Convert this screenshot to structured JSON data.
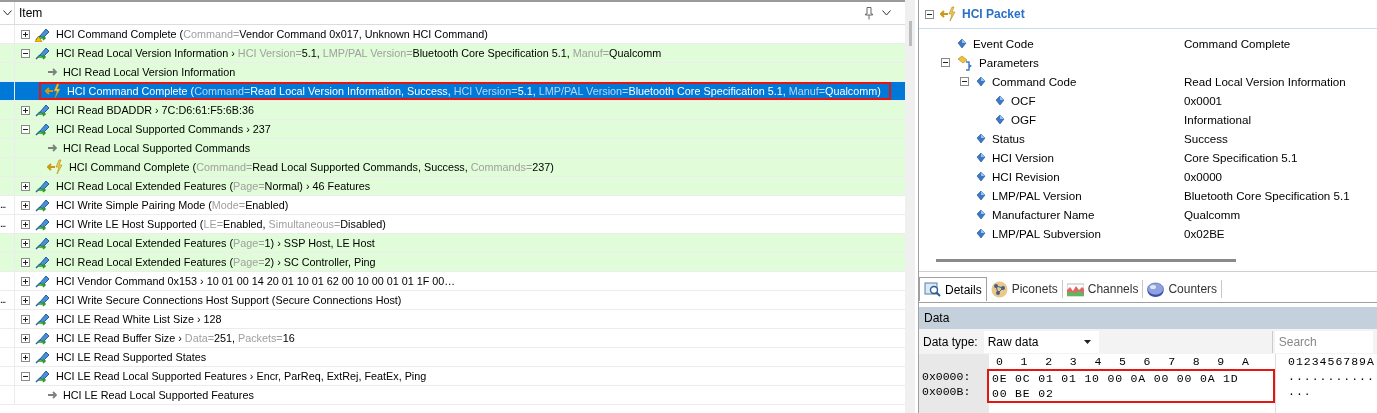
{
  "list_header": {
    "title": "Item"
  },
  "rows": [
    {
      "kind": "group",
      "expanded": false,
      "highlighted": false,
      "selected": false,
      "annotated": false,
      "warning": true,
      "parts": [
        {
          "text": "HCI Command Complete (",
          "muted": false
        },
        {
          "text": "Command=",
          "muted": true
        },
        {
          "text": "Vendor Command 0x017, Unknown HCI Command)",
          "muted": false
        }
      ]
    },
    {
      "kind": "group",
      "expanded": true,
      "highlighted": true,
      "selected": false,
      "annotated": false,
      "warning": false,
      "parts": [
        {
          "text": "HCI Read Local Version Information › ",
          "muted": false
        },
        {
          "text": "HCI Version=",
          "muted": true
        },
        {
          "text": "5.1, ",
          "muted": false
        },
        {
          "text": "LMP/PAL Version=",
          "muted": true
        },
        {
          "text": "Bluetooth Core Specification 5.1, ",
          "muted": false
        },
        {
          "text": "Manuf=",
          "muted": true
        },
        {
          "text": "Qualcomm",
          "muted": false
        }
      ],
      "children": [
        {
          "kind": "command",
          "highlighted": true,
          "selected": false,
          "annotated": false,
          "parts": [
            {
              "text": "HCI Read Local Version Information",
              "muted": false
            }
          ]
        },
        {
          "kind": "event",
          "highlighted": true,
          "selected": true,
          "annotated": true,
          "parts": [
            {
              "text": "HCI Command Complete (",
              "muted": false
            },
            {
              "text": "Command=",
              "muted": true
            },
            {
              "text": "Read Local Version Information, Success, ",
              "muted": false
            },
            {
              "text": "HCI Version=",
              "muted": true
            },
            {
              "text": "5.1, ",
              "muted": false
            },
            {
              "text": "LMP/PAL Version=",
              "muted": true
            },
            {
              "text": "Bluetooth Core Specification 5.1, ",
              "muted": false
            },
            {
              "text": "Manuf=",
              "muted": true
            },
            {
              "text": "Qualcomm)",
              "muted": false
            }
          ]
        }
      ]
    },
    {
      "kind": "group",
      "expanded": false,
      "highlighted": true,
      "selected": false,
      "annotated": false,
      "warning": false,
      "parts": [
        {
          "text": "HCI Read BDADDR › 7C:D6:61:F5:6B:36",
          "muted": false
        }
      ]
    },
    {
      "kind": "group",
      "expanded": true,
      "highlighted": true,
      "selected": false,
      "annotated": false,
      "warning": false,
      "parts": [
        {
          "text": "HCI Read Local Supported Commands › 237",
          "muted": false
        }
      ],
      "children": [
        {
          "kind": "command",
          "highlighted": true,
          "selected": false,
          "annotated": false,
          "parts": [
            {
              "text": "HCI Read Local Supported Commands",
              "muted": false
            }
          ]
        },
        {
          "kind": "event",
          "highlighted": true,
          "selected": false,
          "annotated": false,
          "parts": [
            {
              "text": "HCI Command Complete (",
              "muted": false
            },
            {
              "text": "Command=",
              "muted": true
            },
            {
              "text": "Read Local Supported Commands, Success, ",
              "muted": false
            },
            {
              "text": "Commands=",
              "muted": true
            },
            {
              "text": "237)",
              "muted": false
            }
          ]
        }
      ]
    },
    {
      "kind": "group",
      "expanded": false,
      "highlighted": true,
      "selected": false,
      "annotated": false,
      "warning": false,
      "parts": [
        {
          "text": "HCI Read Local Extended Features (",
          "muted": false
        },
        {
          "text": "Page=",
          "muted": true
        },
        {
          "text": "Normal) › 46 Features",
          "muted": false
        }
      ]
    },
    {
      "kind": "group",
      "prefix": "...",
      "expanded": false,
      "highlighted": false,
      "selected": false,
      "annotated": false,
      "warning": false,
      "parts": [
        {
          "text": "HCI Write Simple Pairing Mode (",
          "muted": false
        },
        {
          "text": "Mode=",
          "muted": true
        },
        {
          "text": "Enabled)",
          "muted": false
        }
      ]
    },
    {
      "kind": "group",
      "prefix": "...",
      "expanded": false,
      "highlighted": false,
      "selected": false,
      "annotated": false,
      "warning": false,
      "parts": [
        {
          "text": "HCI Write LE Host Supported (",
          "muted": false
        },
        {
          "text": "LE=",
          "muted": true
        },
        {
          "text": "Enabled, ",
          "muted": false
        },
        {
          "text": "Simultaneous=",
          "muted": true
        },
        {
          "text": "Disabled)",
          "muted": false
        }
      ]
    },
    {
      "kind": "group",
      "expanded": false,
      "highlighted": true,
      "selected": false,
      "annotated": false,
      "warning": false,
      "parts": [
        {
          "text": "HCI Read Local Extended Features (",
          "muted": false
        },
        {
          "text": "Page=",
          "muted": true
        },
        {
          "text": "1) › SSP Host, LE Host",
          "muted": false
        }
      ]
    },
    {
      "kind": "group",
      "expanded": false,
      "highlighted": true,
      "selected": false,
      "annotated": false,
      "warning": false,
      "parts": [
        {
          "text": "HCI Read Local Extended Features (",
          "muted": false
        },
        {
          "text": "Page=",
          "muted": true
        },
        {
          "text": "2) › SC Controller, Ping",
          "muted": false
        }
      ]
    },
    {
      "kind": "group",
      "expanded": false,
      "highlighted": false,
      "selected": false,
      "annotated": false,
      "warning": false,
      "parts": [
        {
          "text": "HCI Vendor Command 0x153 › 10 01 00 14 20 01 10 01 62 00 10 00 01 01 1F 00…",
          "muted": false
        }
      ]
    },
    {
      "kind": "group",
      "prefix": "...",
      "expanded": false,
      "highlighted": false,
      "selected": false,
      "annotated": false,
      "warning": false,
      "parts": [
        {
          "text": "HCI Write Secure Connections Host Support (Secure Connections Host)",
          "muted": false
        }
      ]
    },
    {
      "kind": "group",
      "expanded": false,
      "highlighted": false,
      "selected": false,
      "annotated": false,
      "warning": false,
      "parts": [
        {
          "text": "HCI LE Read White List Size › 128",
          "muted": false
        }
      ]
    },
    {
      "kind": "group",
      "expanded": false,
      "highlighted": false,
      "selected": false,
      "annotated": false,
      "warning": false,
      "parts": [
        {
          "text": "HCI LE Read Buffer Size › ",
          "muted": false
        },
        {
          "text": "Data=",
          "muted": true
        },
        {
          "text": "251, ",
          "muted": false
        },
        {
          "text": "Packets=",
          "muted": true
        },
        {
          "text": "16",
          "muted": false
        }
      ]
    },
    {
      "kind": "group",
      "expanded": false,
      "highlighted": false,
      "selected": false,
      "annotated": false,
      "warning": false,
      "parts": [
        {
          "text": "HCI LE Read Supported States",
          "muted": false
        }
      ]
    },
    {
      "kind": "group",
      "expanded": true,
      "highlighted": false,
      "selected": false,
      "annotated": false,
      "warning": false,
      "parts": [
        {
          "text": "HCI LE Read Local Supported Features › Encr, ParReq, ExtRej, FeatEx, Ping",
          "muted": false
        }
      ],
      "children": [
        {
          "kind": "command",
          "highlighted": false,
          "selected": false,
          "annotated": false,
          "parts": [
            {
              "text": "HCI LE Read Local Supported Features",
              "muted": false
            }
          ]
        }
      ]
    }
  ],
  "details": {
    "title": "HCI Packet",
    "expanded": true,
    "properties": [
      {
        "kind": "field",
        "name": "Event Code",
        "value": "Command Complete"
      },
      {
        "kind": "group",
        "name": "Parameters",
        "expanded": true,
        "children": [
          {
            "kind": "field",
            "name": "Command Code",
            "value": "Read Local Version Information",
            "expanded": true,
            "children": [
              {
                "kind": "field",
                "name": "OCF",
                "value": "0x0001"
              },
              {
                "kind": "field",
                "name": "OGF",
                "value": "Informational"
              }
            ]
          },
          {
            "kind": "field",
            "name": "Status",
            "value": "Success"
          },
          {
            "kind": "field",
            "name": "HCI Version",
            "value": "Core Specification 5.1"
          },
          {
            "kind": "field",
            "name": "HCI Revision",
            "value": "0x0000"
          },
          {
            "kind": "field",
            "name": "LMP/PAL Version",
            "value": "Bluetooth Core Specification 5.1"
          },
          {
            "kind": "field",
            "name": "Manufacturer Name",
            "value": "Qualcomm"
          },
          {
            "kind": "field",
            "name": "LMP/PAL Subversion",
            "value": "0x02BE"
          }
        ]
      }
    ]
  },
  "bottom_tabs": [
    {
      "label": "Details",
      "selected": true
    },
    {
      "label": "Piconets",
      "selected": false
    },
    {
      "label": "Channels",
      "selected": false
    },
    {
      "label": "Counters",
      "selected": false
    }
  ],
  "data_panel": {
    "title": "Data",
    "data_type_label": "Data type:",
    "data_type": "Raw data",
    "search_placeholder": "Search",
    "columns": [
      "0",
      "1",
      "2",
      "3",
      "4",
      "5",
      "6",
      "7",
      "8",
      "9",
      "A"
    ],
    "ascii_header": "0123456789A",
    "annotated": true,
    "rows": [
      {
        "offset": "0x0000:",
        "bytes": "0E 0C 01 01 10 00 0A 00 00 0A 1D",
        "ascii": "..........."
      },
      {
        "offset": "0x000B:",
        "bytes": "00 BE 02",
        "ascii": "..."
      }
    ]
  }
}
